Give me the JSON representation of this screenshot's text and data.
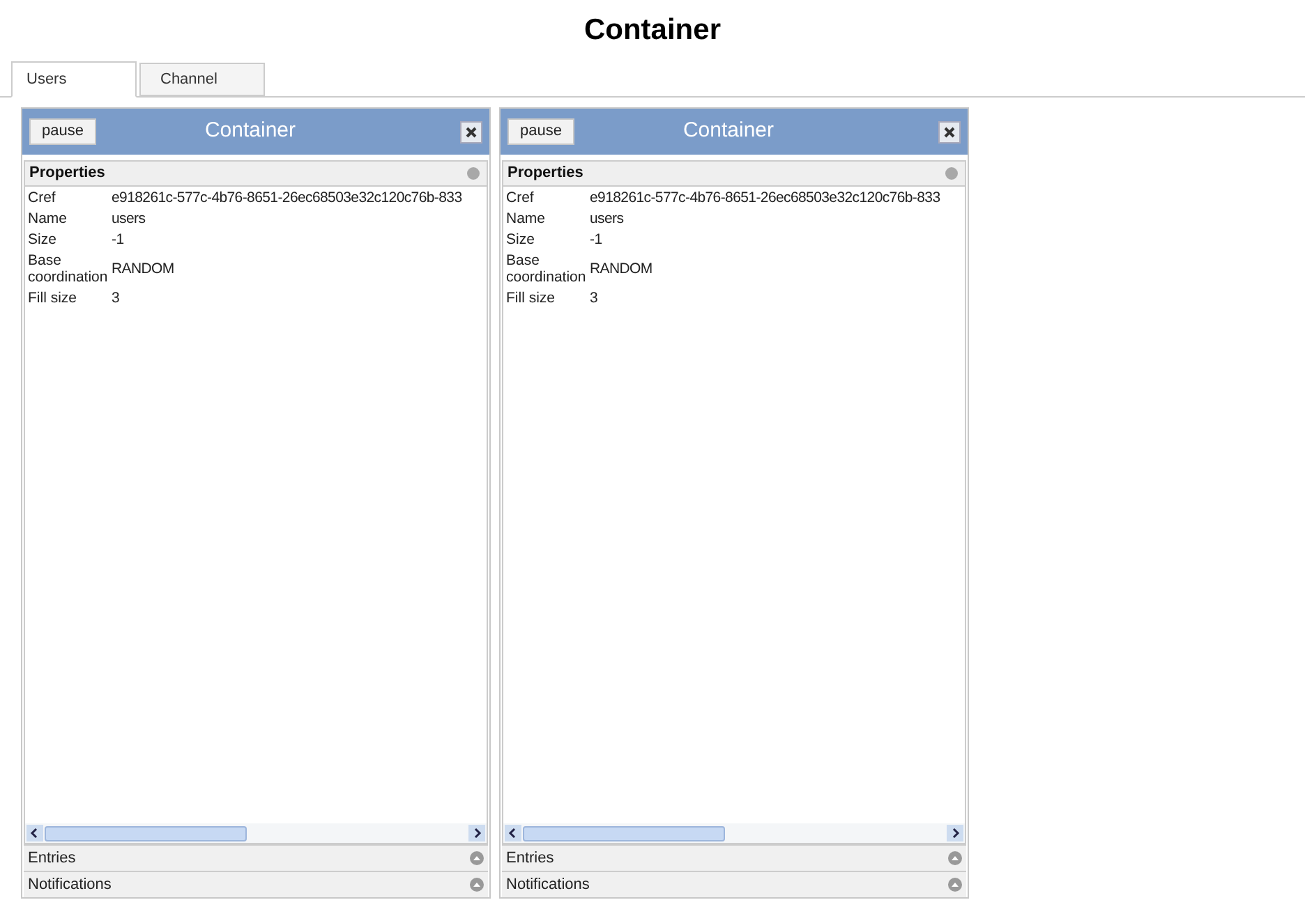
{
  "page_title": "Container",
  "tabs": [
    {
      "label": "Users",
      "selected": true
    },
    {
      "label": "Channel",
      "selected": false
    }
  ],
  "panels": [
    {
      "pause_button": "pause",
      "title": "Container",
      "properties_title": "Properties",
      "rows": [
        {
          "label": "Cref",
          "value": "e918261c-577c-4b76-8651-26ec68503e32c120c76b-833"
        },
        {
          "label": "Name",
          "value": "users"
        },
        {
          "label": "Size",
          "value": "-1"
        },
        {
          "label": "Base coordination",
          "value": "RANDOM"
        },
        {
          "label": "Fill size",
          "value": "3"
        }
      ],
      "sections": [
        "Entries",
        "Notifications"
      ]
    },
    {
      "pause_button": "pause",
      "title": "Container",
      "properties_title": "Properties",
      "rows": [
        {
          "label": "Cref",
          "value": "e918261c-577c-4b76-8651-26ec68503e32c120c76b-833"
        },
        {
          "label": "Name",
          "value": "users"
        },
        {
          "label": "Size",
          "value": "-1"
        },
        {
          "label": "Base coordination",
          "value": "RANDOM"
        },
        {
          "label": "Fill size",
          "value": "3"
        }
      ],
      "sections": [
        "Entries",
        "Notifications"
      ]
    }
  ]
}
